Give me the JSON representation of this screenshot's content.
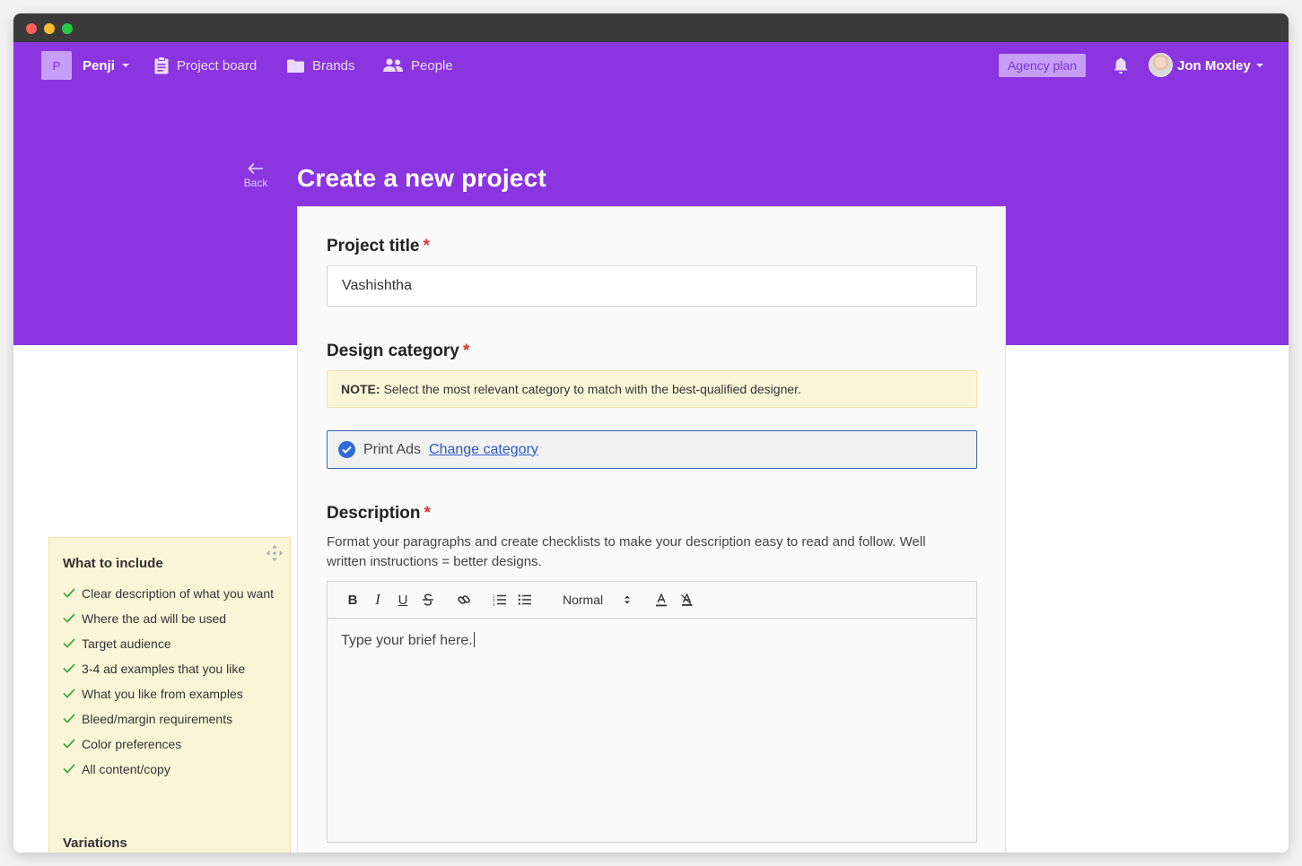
{
  "nav": {
    "workspace_initial": "P",
    "workspace_name": "Penji",
    "items": [
      {
        "label": "Project board",
        "icon": "clipboard-icon"
      },
      {
        "label": "Brands",
        "icon": "folder-icon"
      },
      {
        "label": "People",
        "icon": "people-icon"
      }
    ],
    "plan_button": "Agency plan",
    "user_name": "Jon Moxley"
  },
  "header": {
    "back_label": "Back",
    "title": "Create a new project"
  },
  "form": {
    "project_title": {
      "label": "Project title",
      "required_mark": "*",
      "value": "Vashishtha"
    },
    "design_category": {
      "label": "Design category",
      "required_mark": "*",
      "note_prefix": "NOTE:",
      "note_text": "Select the most relevant category to match with the best-qualified designer.",
      "selected": "Print Ads",
      "change_link": "Change category"
    },
    "description": {
      "label": "Description",
      "required_mark": "*",
      "help_text": "Format your paragraphs and create checklists to make your description easy to read and follow. Well written instructions = better designs.",
      "toolbar": {
        "bold": "B",
        "italic": "I",
        "underline": "U",
        "format_select": "Normal"
      },
      "body_text": "Type your brief here."
    }
  },
  "sidebar": {
    "heading": "What to include",
    "items": [
      "Clear description of what you want",
      "Where the ad will be used",
      "Target audience",
      "3-4 ad examples that you like",
      "What you like from examples",
      "Bleed/margin requirements",
      "Color preferences",
      "All content/copy"
    ],
    "section2_heading": "Variations"
  },
  "colors": {
    "brand_purple": "#8a35e0",
    "badge_purple": "#c79ef7",
    "link_blue": "#2b5cc8",
    "required_red": "#dd3333",
    "check_green": "#3ca63c",
    "note_yellow": "#fbf5d8"
  }
}
